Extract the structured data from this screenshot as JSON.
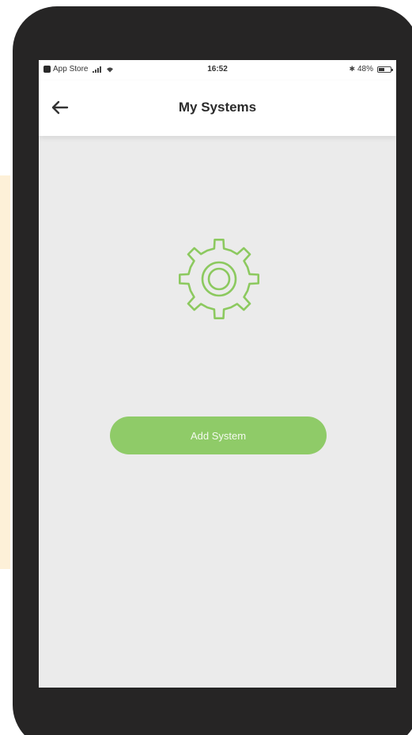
{
  "status_bar": {
    "carrier": "App Store",
    "time": "16:52",
    "battery_percent": "48%",
    "battery_level": 0.48,
    "icons": [
      "app-store-back-icon",
      "signal-icon",
      "wifi-icon",
      "bluetooth-icon",
      "battery-icon"
    ]
  },
  "nav_bar": {
    "title": "My Systems",
    "back_icon": "back-arrow-icon"
  },
  "main": {
    "icon": "gear-icon",
    "add_button_label": "Add System"
  },
  "colors": {
    "accent": "#8fcb68",
    "icon_green": "#8cc95f",
    "background": "#ebebeb",
    "device_frame": "#262525"
  }
}
